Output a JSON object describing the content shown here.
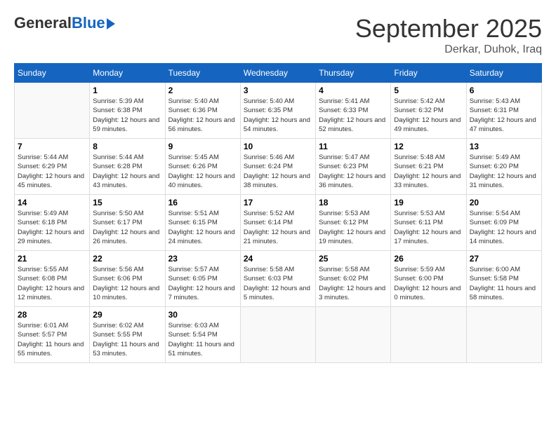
{
  "header": {
    "logo_general": "General",
    "logo_blue": "Blue",
    "month_title": "September 2025",
    "location": "Derkar, Duhok, Iraq"
  },
  "weekdays": [
    "Sunday",
    "Monday",
    "Tuesday",
    "Wednesday",
    "Thursday",
    "Friday",
    "Saturday"
  ],
  "weeks": [
    [
      {
        "day": "",
        "sunrise": "",
        "sunset": "",
        "daylight": ""
      },
      {
        "day": "1",
        "sunrise": "Sunrise: 5:39 AM",
        "sunset": "Sunset: 6:38 PM",
        "daylight": "Daylight: 12 hours and 59 minutes."
      },
      {
        "day": "2",
        "sunrise": "Sunrise: 5:40 AM",
        "sunset": "Sunset: 6:36 PM",
        "daylight": "Daylight: 12 hours and 56 minutes."
      },
      {
        "day": "3",
        "sunrise": "Sunrise: 5:40 AM",
        "sunset": "Sunset: 6:35 PM",
        "daylight": "Daylight: 12 hours and 54 minutes."
      },
      {
        "day": "4",
        "sunrise": "Sunrise: 5:41 AM",
        "sunset": "Sunset: 6:33 PM",
        "daylight": "Daylight: 12 hours and 52 minutes."
      },
      {
        "day": "5",
        "sunrise": "Sunrise: 5:42 AM",
        "sunset": "Sunset: 6:32 PM",
        "daylight": "Daylight: 12 hours and 49 minutes."
      },
      {
        "day": "6",
        "sunrise": "Sunrise: 5:43 AM",
        "sunset": "Sunset: 6:31 PM",
        "daylight": "Daylight: 12 hours and 47 minutes."
      }
    ],
    [
      {
        "day": "7",
        "sunrise": "Sunrise: 5:44 AM",
        "sunset": "Sunset: 6:29 PM",
        "daylight": "Daylight: 12 hours and 45 minutes."
      },
      {
        "day": "8",
        "sunrise": "Sunrise: 5:44 AM",
        "sunset": "Sunset: 6:28 PM",
        "daylight": "Daylight: 12 hours and 43 minutes."
      },
      {
        "day": "9",
        "sunrise": "Sunrise: 5:45 AM",
        "sunset": "Sunset: 6:26 PM",
        "daylight": "Daylight: 12 hours and 40 minutes."
      },
      {
        "day": "10",
        "sunrise": "Sunrise: 5:46 AM",
        "sunset": "Sunset: 6:24 PM",
        "daylight": "Daylight: 12 hours and 38 minutes."
      },
      {
        "day": "11",
        "sunrise": "Sunrise: 5:47 AM",
        "sunset": "Sunset: 6:23 PM",
        "daylight": "Daylight: 12 hours and 36 minutes."
      },
      {
        "day": "12",
        "sunrise": "Sunrise: 5:48 AM",
        "sunset": "Sunset: 6:21 PM",
        "daylight": "Daylight: 12 hours and 33 minutes."
      },
      {
        "day": "13",
        "sunrise": "Sunrise: 5:49 AM",
        "sunset": "Sunset: 6:20 PM",
        "daylight": "Daylight: 12 hours and 31 minutes."
      }
    ],
    [
      {
        "day": "14",
        "sunrise": "Sunrise: 5:49 AM",
        "sunset": "Sunset: 6:18 PM",
        "daylight": "Daylight: 12 hours and 29 minutes."
      },
      {
        "day": "15",
        "sunrise": "Sunrise: 5:50 AM",
        "sunset": "Sunset: 6:17 PM",
        "daylight": "Daylight: 12 hours and 26 minutes."
      },
      {
        "day": "16",
        "sunrise": "Sunrise: 5:51 AM",
        "sunset": "Sunset: 6:15 PM",
        "daylight": "Daylight: 12 hours and 24 minutes."
      },
      {
        "day": "17",
        "sunrise": "Sunrise: 5:52 AM",
        "sunset": "Sunset: 6:14 PM",
        "daylight": "Daylight: 12 hours and 21 minutes."
      },
      {
        "day": "18",
        "sunrise": "Sunrise: 5:53 AM",
        "sunset": "Sunset: 6:12 PM",
        "daylight": "Daylight: 12 hours and 19 minutes."
      },
      {
        "day": "19",
        "sunrise": "Sunrise: 5:53 AM",
        "sunset": "Sunset: 6:11 PM",
        "daylight": "Daylight: 12 hours and 17 minutes."
      },
      {
        "day": "20",
        "sunrise": "Sunrise: 5:54 AM",
        "sunset": "Sunset: 6:09 PM",
        "daylight": "Daylight: 12 hours and 14 minutes."
      }
    ],
    [
      {
        "day": "21",
        "sunrise": "Sunrise: 5:55 AM",
        "sunset": "Sunset: 6:08 PM",
        "daylight": "Daylight: 12 hours and 12 minutes."
      },
      {
        "day": "22",
        "sunrise": "Sunrise: 5:56 AM",
        "sunset": "Sunset: 6:06 PM",
        "daylight": "Daylight: 12 hours and 10 minutes."
      },
      {
        "day": "23",
        "sunrise": "Sunrise: 5:57 AM",
        "sunset": "Sunset: 6:05 PM",
        "daylight": "Daylight: 12 hours and 7 minutes."
      },
      {
        "day": "24",
        "sunrise": "Sunrise: 5:58 AM",
        "sunset": "Sunset: 6:03 PM",
        "daylight": "Daylight: 12 hours and 5 minutes."
      },
      {
        "day": "25",
        "sunrise": "Sunrise: 5:58 AM",
        "sunset": "Sunset: 6:02 PM",
        "daylight": "Daylight: 12 hours and 3 minutes."
      },
      {
        "day": "26",
        "sunrise": "Sunrise: 5:59 AM",
        "sunset": "Sunset: 6:00 PM",
        "daylight": "Daylight: 12 hours and 0 minutes."
      },
      {
        "day": "27",
        "sunrise": "Sunrise: 6:00 AM",
        "sunset": "Sunset: 5:58 PM",
        "daylight": "Daylight: 11 hours and 58 minutes."
      }
    ],
    [
      {
        "day": "28",
        "sunrise": "Sunrise: 6:01 AM",
        "sunset": "Sunset: 5:57 PM",
        "daylight": "Daylight: 11 hours and 55 minutes."
      },
      {
        "day": "29",
        "sunrise": "Sunrise: 6:02 AM",
        "sunset": "Sunset: 5:55 PM",
        "daylight": "Daylight: 11 hours and 53 minutes."
      },
      {
        "day": "30",
        "sunrise": "Sunrise: 6:03 AM",
        "sunset": "Sunset: 5:54 PM",
        "daylight": "Daylight: 11 hours and 51 minutes."
      },
      {
        "day": "",
        "sunrise": "",
        "sunset": "",
        "daylight": ""
      },
      {
        "day": "",
        "sunrise": "",
        "sunset": "",
        "daylight": ""
      },
      {
        "day": "",
        "sunrise": "",
        "sunset": "",
        "daylight": ""
      },
      {
        "day": "",
        "sunrise": "",
        "sunset": "",
        "daylight": ""
      }
    ]
  ]
}
